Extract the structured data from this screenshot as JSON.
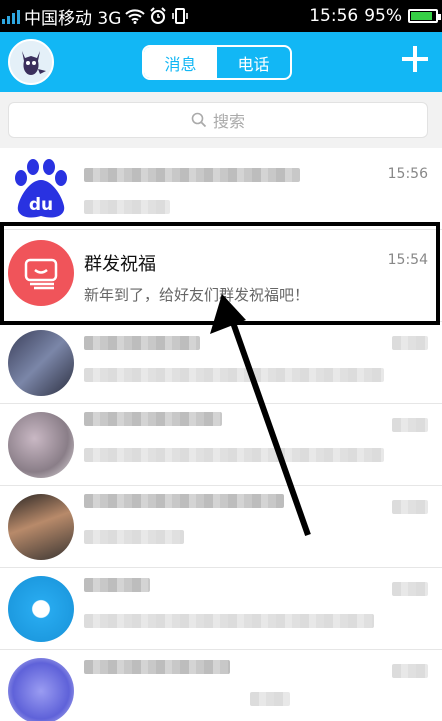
{
  "status_bar": {
    "carrier": "中国移动 3G",
    "time": "15:56",
    "battery": "95%",
    "battery_level": 0.95,
    "icons": [
      "signal-icon",
      "wifi-icon",
      "alarm-icon",
      "vibrate-icon",
      "battery-icon"
    ]
  },
  "header": {
    "tabs": [
      {
        "label": "消息",
        "active": true
      },
      {
        "label": "电话",
        "active": false
      }
    ],
    "add_icon": "plus-icon"
  },
  "search": {
    "placeholder": "搜索"
  },
  "conversations": [
    {
      "avatar": "baidu-logo",
      "title": "",
      "subtitle": "",
      "time": "15:56"
    },
    {
      "avatar": "group-message-icon",
      "title": "群发祝福",
      "subtitle": "新年到了，给好友们群发祝福吧！",
      "time": "15:54"
    },
    {
      "avatar": "contact-avatar",
      "title": "",
      "subtitle": "",
      "time": ""
    },
    {
      "avatar": "contact-avatar",
      "title": "",
      "subtitle": "",
      "time": ""
    },
    {
      "avatar": "contact-avatar",
      "title": "",
      "subtitle": "",
      "time": ""
    },
    {
      "avatar": "contact-avatar",
      "title": "",
      "subtitle": "",
      "time": ""
    },
    {
      "avatar": "contact-avatar",
      "title": "",
      "subtitle": "",
      "time": ""
    }
  ],
  "colors": {
    "header": "#12b7f5",
    "baidu_blue": "#2932e1",
    "group_icon": "#f0545a",
    "highlight_border": "#000000",
    "arrow": "#000000"
  }
}
